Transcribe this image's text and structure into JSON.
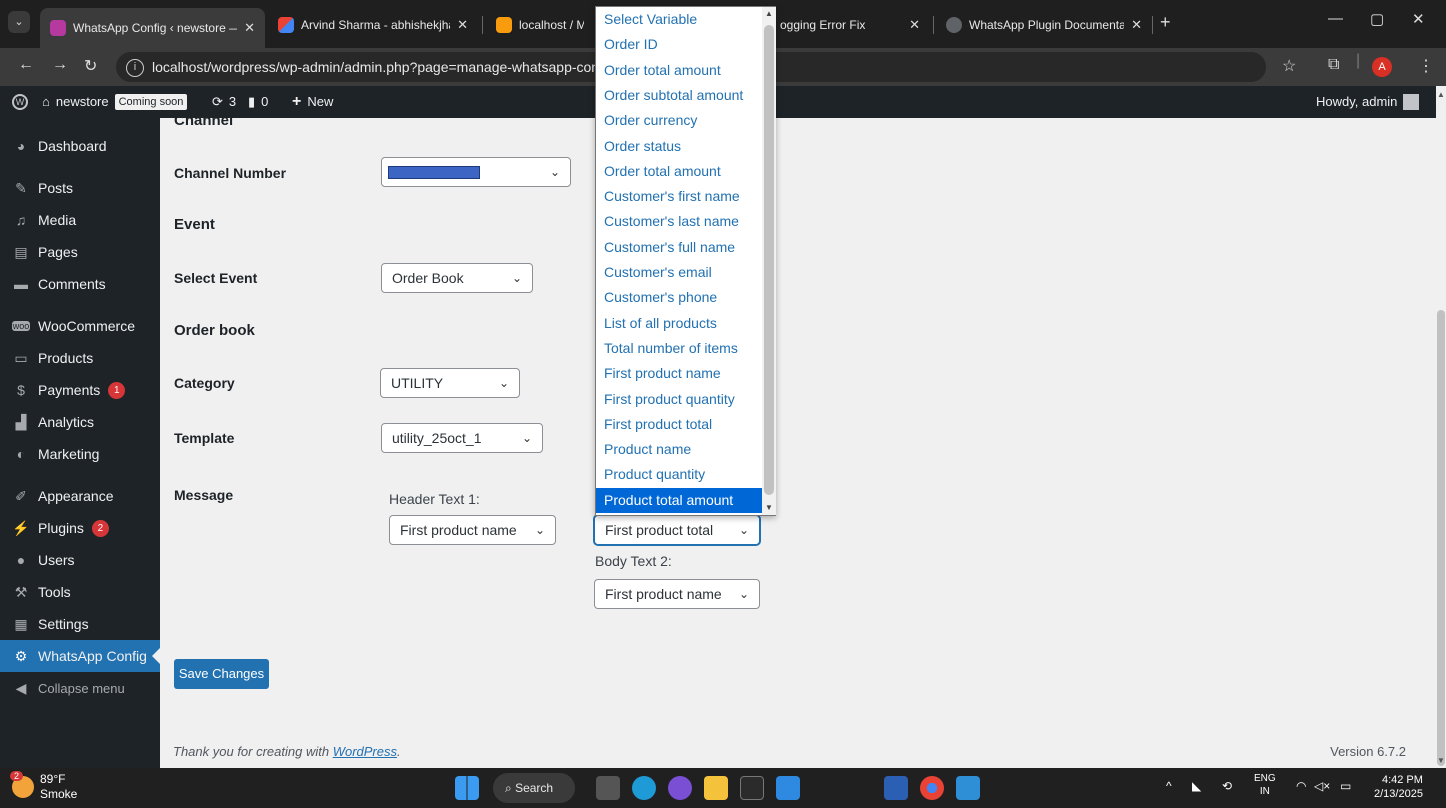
{
  "browser": {
    "tabs": [
      {
        "title": "WhatsApp Config ‹ newstore —",
        "active": true
      },
      {
        "title": "Arvind Sharma - abhishekjha.al"
      },
      {
        "title": "localhost / MyS"
      },
      {
        "title": "ogging Error Fix"
      },
      {
        "title": "WhatsApp Plugin Documentati"
      }
    ],
    "url": "localhost/wordpress/wp-admin/admin.php?page=manage-whatsapp-config",
    "profile_initial": "A"
  },
  "adminbar": {
    "site_name": "newstore",
    "coming_soon": "Coming soon",
    "updates_count": "3",
    "comments_count": "0",
    "new_label": "New",
    "greeting": "Howdy, admin"
  },
  "sidebar": {
    "items": [
      {
        "label": "Dashboard",
        "icon": "dashboard-icon"
      },
      {
        "label": "Posts",
        "icon": "pin-icon"
      },
      {
        "label": "Media",
        "icon": "media-icon"
      },
      {
        "label": "Pages",
        "icon": "page-icon"
      },
      {
        "label": "Comments",
        "icon": "comment-icon"
      },
      {
        "label": "WooCommerce",
        "icon": "woo-icon"
      },
      {
        "label": "Products",
        "icon": "products-icon"
      },
      {
        "label": "Payments",
        "icon": "payments-icon",
        "badge": "1"
      },
      {
        "label": "Analytics",
        "icon": "chart-icon"
      },
      {
        "label": "Marketing",
        "icon": "megaphone-icon"
      },
      {
        "label": "Appearance",
        "icon": "brush-icon"
      },
      {
        "label": "Plugins",
        "icon": "plug-icon",
        "badge": "2"
      },
      {
        "label": "Users",
        "icon": "users-icon"
      },
      {
        "label": "Tools",
        "icon": "wrench-icon"
      },
      {
        "label": "Settings",
        "icon": "settings-icon"
      },
      {
        "label": "WhatsApp Config",
        "icon": "gear-icon",
        "current": true
      }
    ],
    "collapse_label": "Collapse menu"
  },
  "form": {
    "channel_heading": "Channel",
    "channel_number_label": "Channel Number",
    "event_heading": "Event",
    "select_event_label": "Select Event",
    "select_event_value": "Order Book",
    "order_book_heading": "Order book",
    "category_label": "Category",
    "category_value": "UTILITY",
    "template_label": "Template",
    "template_value": "utility_25oct_1",
    "message_label": "Message",
    "header_text_label": "Header Text 1:",
    "header_text_value": "First product name",
    "body_text1_value": "First product total",
    "body_text2_label": "Body Text 2:",
    "body_text2_value": "First product name",
    "save_label": "Save Changes"
  },
  "dropdown": {
    "options": [
      "Select Variable",
      "Order ID",
      "Order total amount",
      "Order subtotal amount",
      "Order currency",
      "Order status",
      "Order total amount",
      "Customer's first name",
      "Customer's last name",
      "Customer's full name",
      "Customer's email",
      "Customer's phone",
      "List of all products",
      "Total number of items",
      "First product name",
      "First product quantity",
      "First product total",
      "Product name",
      "Product quantity",
      "Product total amount"
    ],
    "selected_index": 19
  },
  "footer": {
    "thanks_prefix": "Thank you for creating with ",
    "thanks_link": "WordPress",
    "thanks_suffix": ".",
    "version": "Version 6.7.2"
  },
  "taskbar": {
    "weather_temp": "89°F",
    "weather_desc": "Smoke",
    "weather_badge": "2",
    "search_label": "Search",
    "lang_top": "ENG",
    "lang_bottom": "IN",
    "time": "4:42 PM",
    "date": "2/13/2025"
  }
}
